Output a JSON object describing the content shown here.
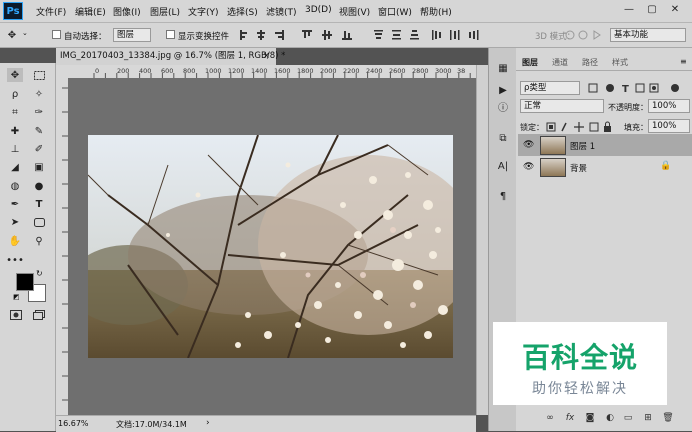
{
  "app": {
    "logo": "Ps"
  },
  "menu": {
    "items": [
      "文件(F)",
      "编辑(E)",
      "图像(I)",
      "图层(L)",
      "文字(Y)",
      "选择(S)",
      "滤镜(T)",
      "3D(D)",
      "视图(V)",
      "窗口(W)",
      "帮助(H)"
    ],
    "window_buttons": [
      "—",
      "▢",
      "✕"
    ]
  },
  "options": {
    "auto_select_label": "自动选择：",
    "auto_select_value": "图层",
    "show_transform_label": "显示变换控件",
    "mode_3d_label": "3D 模式：",
    "workspace_value": "基本功能"
  },
  "document": {
    "tab_title": "IMG_20170403_13384.jpg @ 16.7% (图层 1, RGB/8) *",
    "close": "×",
    "ruler_ticks": [
      "0",
      "200",
      "400",
      "600",
      "800",
      "1000",
      "1200",
      "1400",
      "1600",
      "1800",
      "2000",
      "2200",
      "2400",
      "2600",
      "2800",
      "3000",
      "3200",
      "3400",
      "3600",
      "38"
    ]
  },
  "status": {
    "zoom": "16.67%",
    "doc_info": "文档:17.0M/34.1M"
  },
  "layers_panel": {
    "tabs": [
      "图层",
      "通道",
      "路径",
      "样式"
    ],
    "filter_kind": "ρ类型",
    "blend_mode": "正常",
    "opacity_label": "不透明度：",
    "opacity_value": "100%",
    "lock_label": "锁定：",
    "fill_label": "填充：",
    "fill_value": "100%",
    "layers": [
      {
        "name": "图层 1",
        "selected": true,
        "locked": false
      },
      {
        "name": "背景",
        "selected": false,
        "locked": true
      }
    ],
    "bottom_icons": [
      "link-icon",
      "fx-icon",
      "mask-icon",
      "adjustment-icon",
      "folder-icon",
      "new-layer-icon",
      "trash-icon"
    ]
  },
  "watermark": {
    "title": "百科全说",
    "subtitle": "助你轻松解决"
  },
  "colors": {
    "chrome": "#d6d6d6",
    "canvas_bg": "#6f6f6f",
    "workspace": "#535353",
    "watermark_green": "#15a36a",
    "selected_layer": "#a9a9a9"
  }
}
